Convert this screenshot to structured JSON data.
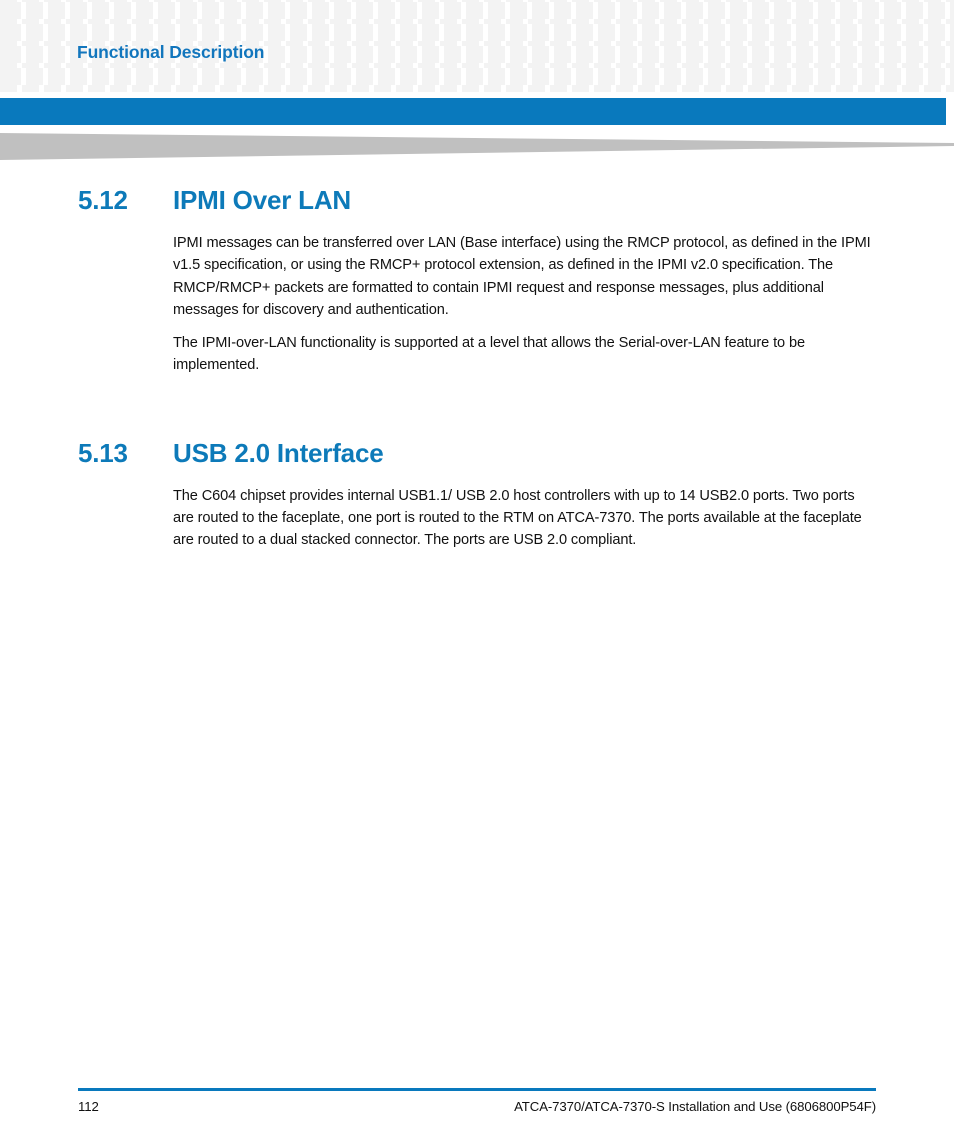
{
  "header": {
    "running_title": "Functional Description",
    "accent_color": "#0979bd",
    "grid_square_color": "#f3f3f3",
    "wedge_color": "#c0c0c0"
  },
  "sections": [
    {
      "number": "5.12",
      "title": "IPMI Over LAN",
      "paragraphs": [
        "IPMI messages can be transferred over LAN (Base interface) using the RMCP protocol, as defined in the IPMI v1.5 specification, or using the RMCP+ protocol extension, as defined in the IPMI v2.0 specification. The RMCP/RMCP+ packets are formatted to contain IPMI request and response messages, plus additional messages for discovery and authentication.",
        "The IPMI-over-LAN functionality is supported at a level that allows the Serial-over-LAN feature to be implemented."
      ]
    },
    {
      "number": "5.13",
      "title": "USB 2.0 Interface",
      "paragraphs": [
        "The C604 chipset provides internal USB1.1/ USB 2.0 host controllers with up to 14 USB2.0 ports. Two ports are routed to the faceplate, one port is routed to the RTM on ATCA-7370. The ports available at the faceplate are routed to a dual stacked connector. The ports are USB 2.0 compliant."
      ]
    }
  ],
  "footer": {
    "page_number": "112",
    "document_title": "ATCA-7370/ATCA-7370-S Installation and Use (6806800P54F)",
    "rule_color": "#0979bd"
  }
}
